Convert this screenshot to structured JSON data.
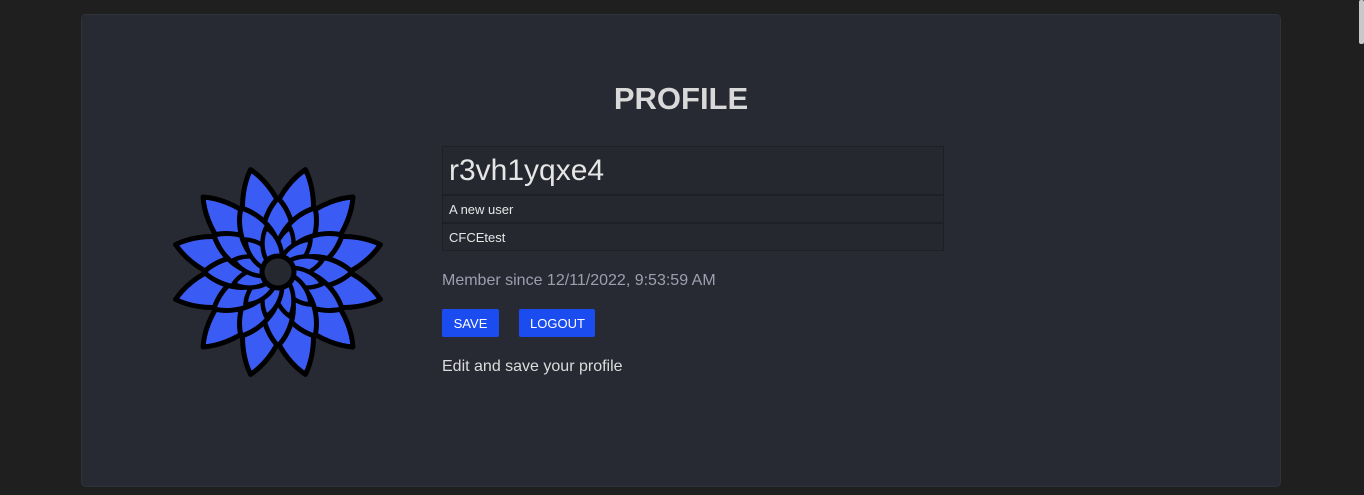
{
  "page": {
    "title": "PROFILE"
  },
  "profile": {
    "username": "r3vh1yqxe4",
    "bio": "A new user",
    "organization": "CFCEtest",
    "member_since": "Member since 12/11/2022, 9:53:59 AM"
  },
  "actions": {
    "save_label": "SAVE",
    "logout_label": "LOGOUT"
  },
  "hint": "Edit and save your profile",
  "avatar": {
    "icon": "flower-mandala-icon",
    "fill_color": "#3a5cf5",
    "stroke_color": "#000000"
  },
  "colors": {
    "accent": "#1b4cf0",
    "card_background": "#282a33",
    "page_background": "#1f1f1f"
  }
}
